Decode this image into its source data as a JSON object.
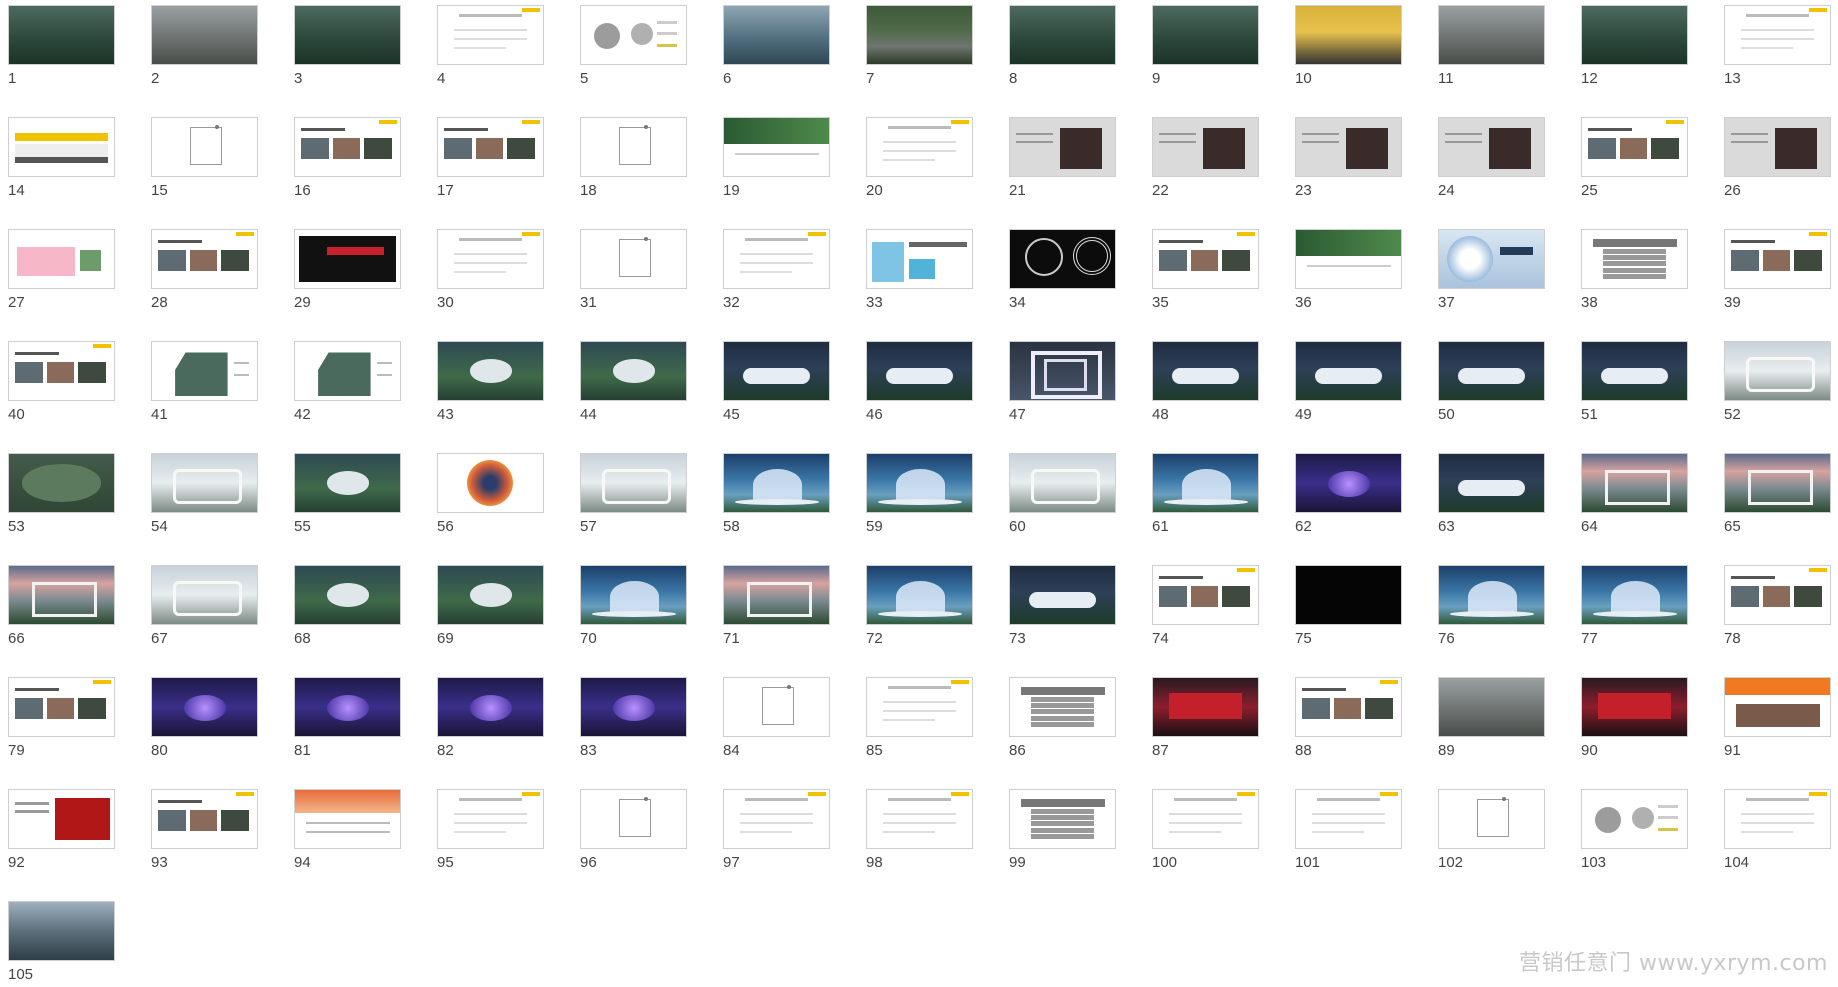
{
  "slide_sorter": {
    "slides": [
      {
        "number": "1",
        "style": "dark-forest"
      },
      {
        "number": "2",
        "style": "photo-gray"
      },
      {
        "number": "3",
        "style": "dark-forest"
      },
      {
        "number": "4",
        "style": "white-text"
      },
      {
        "number": "5",
        "style": "white-diagram"
      },
      {
        "number": "6",
        "style": "photo-lake"
      },
      {
        "number": "7",
        "style": "photo-road"
      },
      {
        "number": "8",
        "style": "dark-forest"
      },
      {
        "number": "9",
        "style": "dark-forest"
      },
      {
        "number": "10",
        "style": "photo-yellow"
      },
      {
        "number": "11",
        "style": "photo-gray"
      },
      {
        "number": "12",
        "style": "dark-forest"
      },
      {
        "number": "13",
        "style": "white-text"
      },
      {
        "number": "14",
        "style": "white-yellow"
      },
      {
        "number": "15",
        "style": "white-section"
      },
      {
        "number": "16",
        "style": "white-photos"
      },
      {
        "number": "17",
        "style": "white-photos"
      },
      {
        "number": "18",
        "style": "white-section"
      },
      {
        "number": "19",
        "style": "green-banner"
      },
      {
        "number": "20",
        "style": "white-text"
      },
      {
        "number": "21",
        "style": "gray-photo"
      },
      {
        "number": "22",
        "style": "gray-photo"
      },
      {
        "number": "23",
        "style": "gray-photo"
      },
      {
        "number": "24",
        "style": "gray-photo"
      },
      {
        "number": "25",
        "style": "white-photos"
      },
      {
        "number": "26",
        "style": "gray-photo"
      },
      {
        "number": "27",
        "style": "white-pink"
      },
      {
        "number": "28",
        "style": "white-photos"
      },
      {
        "number": "29",
        "style": "black-red"
      },
      {
        "number": "30",
        "style": "white-text"
      },
      {
        "number": "31",
        "style": "white-section"
      },
      {
        "number": "32",
        "style": "white-text"
      },
      {
        "number": "33",
        "style": "white-blue"
      },
      {
        "number": "34",
        "style": "black-circle"
      },
      {
        "number": "35",
        "style": "white-photos"
      },
      {
        "number": "36",
        "style": "green-banner"
      },
      {
        "number": "37",
        "style": "blue-orb"
      },
      {
        "number": "38",
        "style": "white-table"
      },
      {
        "number": "39",
        "style": "white-photos"
      },
      {
        "number": "40",
        "style": "white-photos"
      },
      {
        "number": "41",
        "style": "white-map"
      },
      {
        "number": "42",
        "style": "white-map"
      },
      {
        "number": "43",
        "style": "render-aerial"
      },
      {
        "number": "44",
        "style": "render-aerial"
      },
      {
        "number": "45",
        "style": "render-night"
      },
      {
        "number": "46",
        "style": "render-night"
      },
      {
        "number": "47",
        "style": "render-tunnel"
      },
      {
        "number": "48",
        "style": "render-night"
      },
      {
        "number": "49",
        "style": "render-night"
      },
      {
        "number": "50",
        "style": "render-night"
      },
      {
        "number": "51",
        "style": "render-night"
      },
      {
        "number": "52",
        "style": "render-white"
      },
      {
        "number": "53",
        "style": "green-wall"
      },
      {
        "number": "54",
        "style": "render-white"
      },
      {
        "number": "55",
        "style": "render-aerial"
      },
      {
        "number": "56",
        "style": "white-orb"
      },
      {
        "number": "57",
        "style": "render-white"
      },
      {
        "number": "58",
        "style": "render-dome"
      },
      {
        "number": "59",
        "style": "render-dome"
      },
      {
        "number": "60",
        "style": "render-white"
      },
      {
        "number": "61",
        "style": "render-dome"
      },
      {
        "number": "62",
        "style": "render-purple"
      },
      {
        "number": "63",
        "style": "render-night"
      },
      {
        "number": "64",
        "style": "render-sunset"
      },
      {
        "number": "65",
        "style": "render-sunset"
      },
      {
        "number": "66",
        "style": "render-sunset"
      },
      {
        "number": "67",
        "style": "render-white"
      },
      {
        "number": "68",
        "style": "render-aerial"
      },
      {
        "number": "69",
        "style": "render-aerial"
      },
      {
        "number": "70",
        "style": "render-dome"
      },
      {
        "number": "71",
        "style": "render-sunset"
      },
      {
        "number": "72",
        "style": "render-dome"
      },
      {
        "number": "73",
        "style": "render-night"
      },
      {
        "number": "74",
        "style": "white-photos"
      },
      {
        "number": "75",
        "style": "black"
      },
      {
        "number": "76",
        "style": "render-dome"
      },
      {
        "number": "77",
        "style": "render-dome"
      },
      {
        "number": "78",
        "style": "white-photos"
      },
      {
        "number": "79",
        "style": "white-photos"
      },
      {
        "number": "80",
        "style": "render-purple"
      },
      {
        "number": "81",
        "style": "render-purple"
      },
      {
        "number": "82",
        "style": "render-purple"
      },
      {
        "number": "83",
        "style": "render-purple"
      },
      {
        "number": "84",
        "style": "white-section"
      },
      {
        "number": "85",
        "style": "white-text"
      },
      {
        "number": "86",
        "style": "white-table"
      },
      {
        "number": "87",
        "style": "stage-red"
      },
      {
        "number": "88",
        "style": "white-photos"
      },
      {
        "number": "89",
        "style": "photo-gray"
      },
      {
        "number": "90",
        "style": "stage-red"
      },
      {
        "number": "91",
        "style": "white-orange"
      },
      {
        "number": "92",
        "style": "white-red"
      },
      {
        "number": "93",
        "style": "white-photos"
      },
      {
        "number": "94",
        "style": "white-sunset"
      },
      {
        "number": "95",
        "style": "white-text"
      },
      {
        "number": "96",
        "style": "white-section"
      },
      {
        "number": "97",
        "style": "white-text"
      },
      {
        "number": "98",
        "style": "white-text"
      },
      {
        "number": "99",
        "style": "white-table"
      },
      {
        "number": "100",
        "style": "white-text"
      },
      {
        "number": "101",
        "style": "white-text"
      },
      {
        "number": "102",
        "style": "white-section"
      },
      {
        "number": "103",
        "style": "white-diagram"
      },
      {
        "number": "104",
        "style": "white-text"
      },
      {
        "number": "105",
        "style": "photo-sky"
      }
    ]
  },
  "watermark": {
    "text": "营销任意门 www.yxrym.com"
  },
  "colors": {
    "background": "#ffffff",
    "thumb_border": "#cfcfcf",
    "number_text": "#444444",
    "accent_yellow": "#f2c200"
  }
}
